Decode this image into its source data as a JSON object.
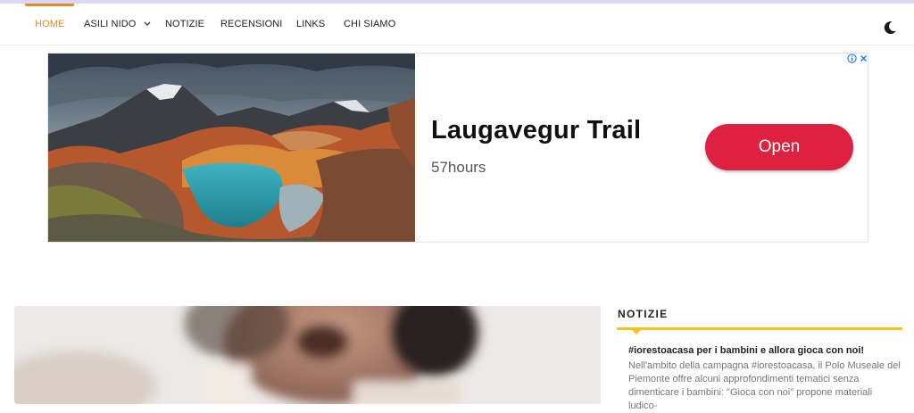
{
  "nav": {
    "items": [
      {
        "label": "HOME",
        "active": true
      },
      {
        "label": "ASILI NIDO",
        "has_dropdown": true
      },
      {
        "label": "NOTIZIE"
      },
      {
        "label": "RECENSIONI"
      },
      {
        "label": "LINKS"
      },
      {
        "label": "CHI SIAMO"
      }
    ],
    "theme_toggle_icon": "moon-icon",
    "accent_color": "#e8872a"
  },
  "ad": {
    "title": "Laugavegur Trail",
    "advertiser": "57hours",
    "cta_label": "Open",
    "cta_color": "#de2140",
    "icons": [
      "ad-info-icon",
      "ad-close-icon"
    ]
  },
  "sidebar": {
    "widget_title": "NOTIZIE",
    "accent_color": "#f3c320",
    "post": {
      "title": "#iorestoacasa per i bambini e allora gioca con noi!",
      "excerpt": "Nell'ambito della campagna #iorestoacasa, il Polo Museale del Piemonte offre alcuni approfondimenti tematici senza dimenticare i bambini: \"Gioca con noi\" propone materiali ludico-"
    }
  }
}
